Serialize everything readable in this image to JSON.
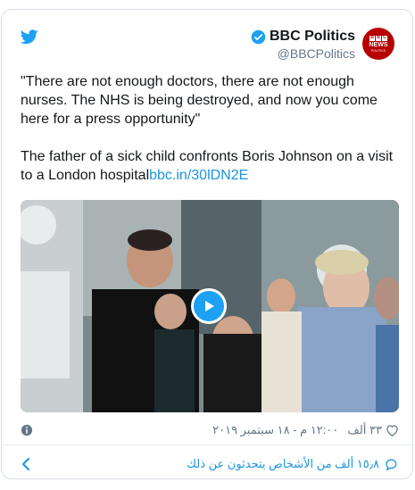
{
  "account": {
    "name": "BBC Politics",
    "handle": "@BBCPolitics"
  },
  "avatar": {
    "letters": [
      "B",
      "B",
      "C"
    ],
    "line1": "NEWS",
    "line2": "POLITICS"
  },
  "tweet": {
    "text": "\"There are not enough doctors, there are not enough nurses. The NHS is being destroyed, and now you come here for a press opportunity\"\n\nThe father of a sick child confronts Boris Johnson on a visit to a London hospital",
    "link": "bbc.in/30lDN2E"
  },
  "meta": {
    "likes": "٣٣ ألف",
    "timestamp": "١٢:٠٠ م - ١٨ سبتمبر ٢٠١٩"
  },
  "footer": {
    "conversation": "١٥٫٨ ألف من الأشخاص يتحدثون عن ذلك"
  },
  "colors": {
    "brand": "#1da1f2",
    "link": "#1b95e0",
    "bbc_red": "#b80000",
    "muted": "#657786"
  },
  "icons": [
    "twitter-bird-icon",
    "verified-badge-icon",
    "play-icon",
    "heart-icon",
    "info-icon",
    "chat-bubble-icon",
    "chevron-left-icon"
  ]
}
